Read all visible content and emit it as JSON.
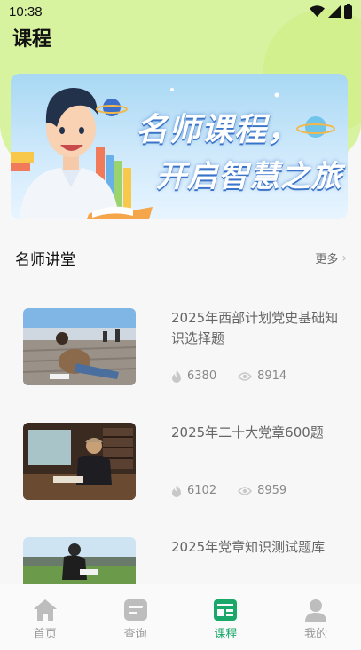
{
  "status_bar": {
    "time": "10:38"
  },
  "header": {
    "title": "课程"
  },
  "banner": {
    "line1": "名师课程，",
    "line2": "开启智慧之旅"
  },
  "section": {
    "title": "名师讲堂",
    "more_label": "更多"
  },
  "courses": [
    {
      "title": "2025年西部计划党史基础知识选择题",
      "hot": "6380",
      "views": "8914"
    },
    {
      "title": "2025年二十大党章600题",
      "hot": "6102",
      "views": "8959"
    },
    {
      "title": "2025年党章知识测试题库",
      "hot": "",
      "views": ""
    }
  ],
  "tabs": [
    {
      "label": "首页",
      "icon": "home-icon"
    },
    {
      "label": "查询",
      "icon": "search-doc-icon"
    },
    {
      "label": "课程",
      "icon": "course-icon",
      "active": true
    },
    {
      "label": "我的",
      "icon": "user-icon"
    }
  ],
  "colors": {
    "accent": "#1aa86a",
    "header_bg": "#d8f3a0"
  }
}
